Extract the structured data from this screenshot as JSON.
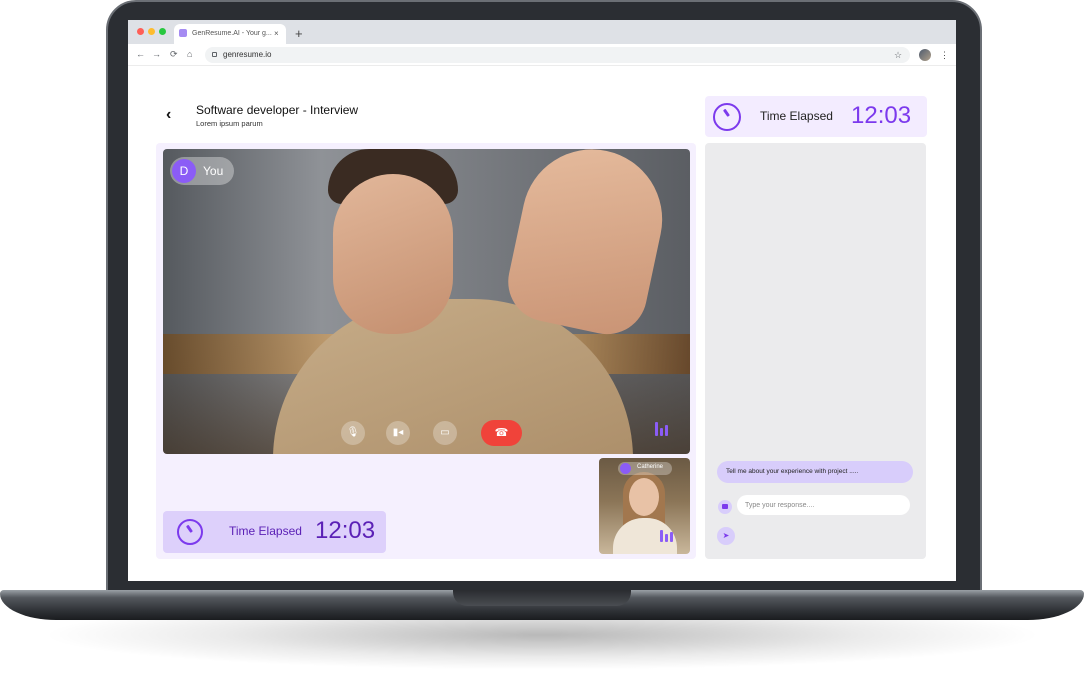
{
  "browser": {
    "tab_title": "GenResume.AI - Your g...",
    "tab_close": "×",
    "new_tab": "+",
    "url": "genresume.io",
    "nav": {
      "back": "←",
      "forward": "→",
      "reload": "⟳",
      "home": "⌂",
      "bookmark": "☆",
      "menu": "⋮"
    }
  },
  "header": {
    "back_icon": "‹",
    "title": "Software developer - Interview",
    "subtitle": "Lorem ipsum parum"
  },
  "call": {
    "self": {
      "initial": "D",
      "name": "You"
    },
    "controls": {
      "mic": "🎙",
      "camera": "▮◂",
      "screen": "▭",
      "hangup": "☎"
    },
    "interviewer": {
      "name": "Catherine"
    }
  },
  "timer": {
    "label": "Time Elapsed",
    "value": "12:03"
  },
  "chat": {
    "bot_message": "Tell me about your experience with project .....",
    "input_placeholder": "Type your response....",
    "send_icon": "➤"
  },
  "colors": {
    "accent": "#7c3aed",
    "accent_light": "#ddd0fb",
    "panel_bg": "#f5f0fe",
    "hangup": "#f0433a"
  }
}
